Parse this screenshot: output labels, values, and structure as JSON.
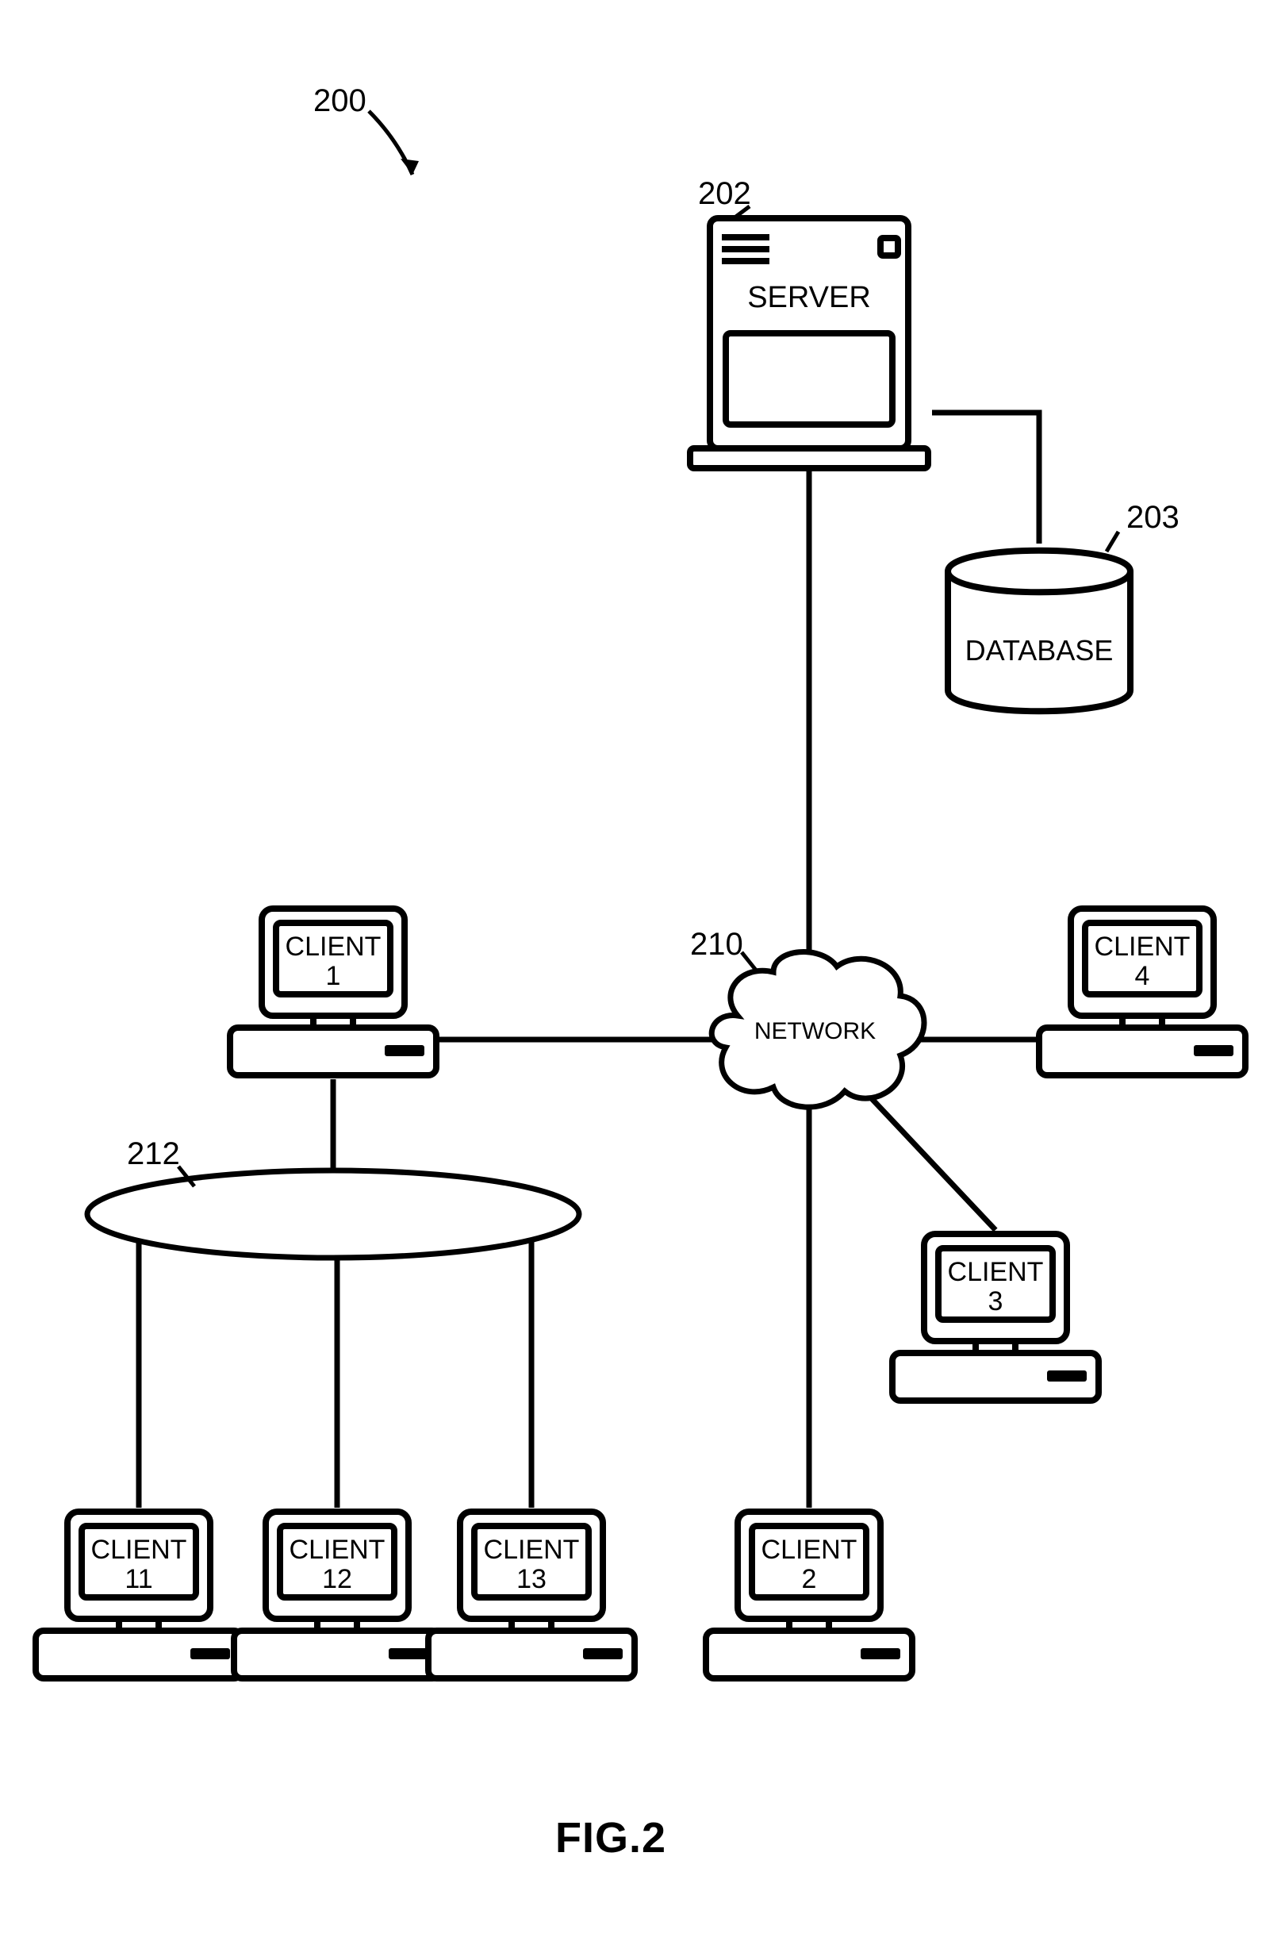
{
  "figure": {
    "number_ref": "200",
    "caption": "FIG.2"
  },
  "refs": {
    "server": "202",
    "database": "203",
    "network": "210",
    "lan_ring": "212"
  },
  "nodes": {
    "server": {
      "label": "SERVER"
    },
    "database": {
      "label": "DATABASE"
    },
    "network": {
      "label": "NETWORK"
    },
    "client1": {
      "line1": "CLIENT",
      "line2": "1"
    },
    "client2": {
      "line1": "CLIENT",
      "line2": "2"
    },
    "client3": {
      "line1": "CLIENT",
      "line2": "3"
    },
    "client4": {
      "line1": "CLIENT",
      "line2": "4"
    },
    "client11": {
      "line1": "CLIENT",
      "line2": "11"
    },
    "client12": {
      "line1": "CLIENT",
      "line2": "12"
    },
    "client13": {
      "line1": "CLIENT",
      "line2": "13"
    }
  }
}
